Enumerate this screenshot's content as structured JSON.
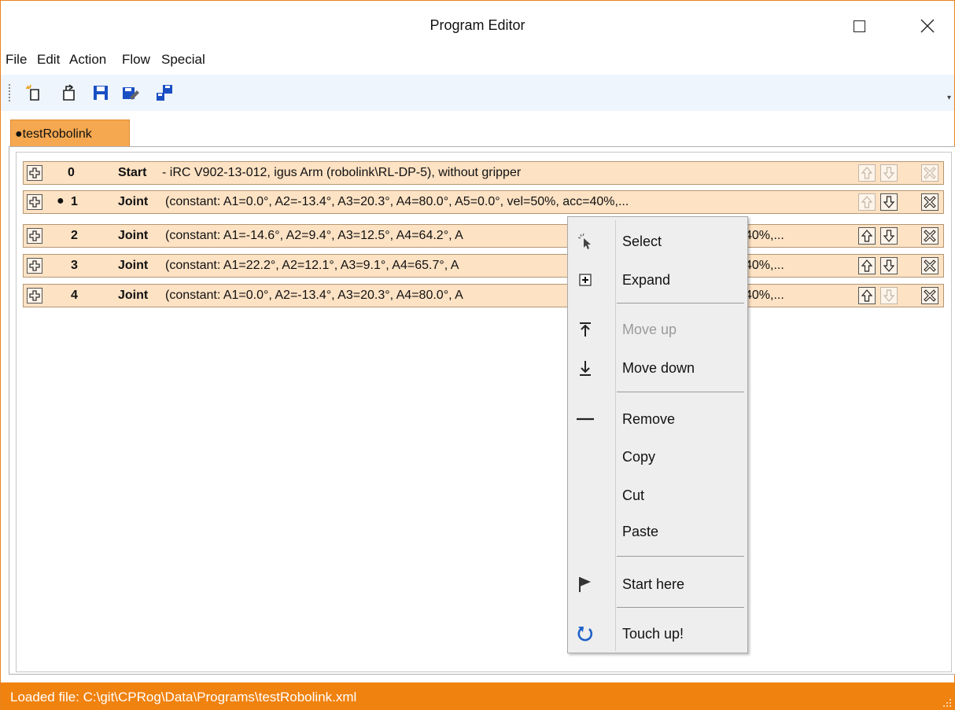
{
  "window": {
    "title": "Program Editor"
  },
  "menu": [
    "File",
    "Edit",
    "Action",
    "Flow",
    "Special"
  ],
  "toolbar": {
    "buttons": [
      "new-program-icon",
      "open-program-icon",
      "save-icon",
      "save-as-icon",
      "send-to-robot-icon"
    ]
  },
  "tab": {
    "label": "●testRobolink"
  },
  "program": {
    "rows": [
      {
        "index": "0",
        "marker": "",
        "kind": "Start",
        "description": "- iRC V902-13-012, igus Arm (robolink\\RL-DP-5), without gripper",
        "description_tail": "",
        "move_up_enabled": false,
        "move_down_enabled": false,
        "remove_enabled": false
      },
      {
        "index": "1",
        "marker": "●",
        "kind": "Joint",
        "description": "(constant: A1=0.0°, A2=-13.4°, A3=20.3°, A4=80.0°, A5=0.0°, vel=50%, acc=40%,...",
        "description_tail": "",
        "move_up_enabled": false,
        "move_down_enabled": true,
        "remove_enabled": true
      },
      {
        "index": "2",
        "marker": "",
        "kind": "Joint",
        "description": "(constant: A1=-14.6°, A2=9.4°, A3=12.5°, A4=64.2°, A",
        "description_tail": "40%,...",
        "move_up_enabled": true,
        "move_down_enabled": true,
        "remove_enabled": true
      },
      {
        "index": "3",
        "marker": "",
        "kind": "Joint",
        "description": "(constant: A1=22.2°, A2=12.1°, A3=9.1°, A4=65.7°, A",
        "description_tail": "40%,...",
        "move_up_enabled": true,
        "move_down_enabled": true,
        "remove_enabled": true
      },
      {
        "index": "4",
        "marker": "",
        "kind": "Joint",
        "description": "(constant: A1=0.0°, A2=-13.4°, A3=20.3°, A4=80.0°, A",
        "description_tail": "40%,...",
        "move_up_enabled": true,
        "move_down_enabled": false,
        "remove_enabled": true
      }
    ]
  },
  "context_menu": {
    "select": "Select",
    "expand": "Expand",
    "move_up": "Move up",
    "move_down": "Move down",
    "remove": "Remove",
    "copy": "Copy",
    "cut": "Cut",
    "paste": "Paste",
    "start_here": "Start here",
    "touch_up": "Touch up!"
  },
  "status": {
    "text": "Loaded file: C:\\git\\CPRog\\Data\\Programs\\testRobolink.xml"
  },
  "colors": {
    "accent": "#f0820f",
    "row_bg": "#fde2c4",
    "tab_bg": "#f5a850",
    "toolbar_bg": "#eef5fd",
    "menu_bg": "#eeeeee"
  }
}
